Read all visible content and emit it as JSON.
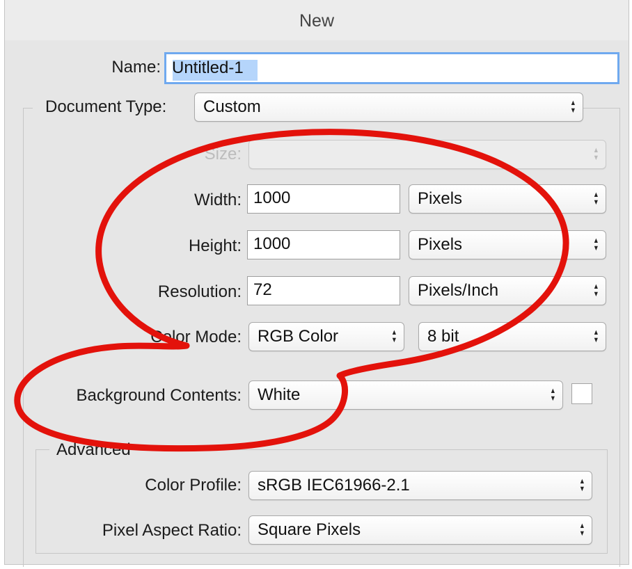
{
  "window": {
    "title": "New"
  },
  "name": {
    "label": "Name:",
    "value": "Untitled-1"
  },
  "document_type": {
    "label": "Document Type:",
    "value": "Custom"
  },
  "size": {
    "label": "Size:",
    "value": ""
  },
  "width": {
    "label": "Width:",
    "value": "1000",
    "unit": "Pixels"
  },
  "height": {
    "label": "Height:",
    "value": "1000",
    "unit": "Pixels"
  },
  "resolution": {
    "label": "Resolution:",
    "value": "72",
    "unit": "Pixels/Inch"
  },
  "color_mode": {
    "label": "Color Mode:",
    "mode": "RGB Color",
    "depth": "8 bit"
  },
  "background": {
    "label": "Background Contents:",
    "value": "White",
    "swatch_color": "#ffffff"
  },
  "advanced": {
    "legend": "Advanced",
    "color_profile": {
      "label": "Color Profile:",
      "value": "sRGB IEC61966-2.1"
    },
    "pixel_aspect": {
      "label": "Pixel Aspect Ratio:",
      "value": "Square Pixels"
    }
  },
  "icons": {
    "popup_arrows": "updown-arrows-icon"
  },
  "annotation": {
    "color": "#e3120b",
    "shape": "hand-drawn double loop"
  }
}
